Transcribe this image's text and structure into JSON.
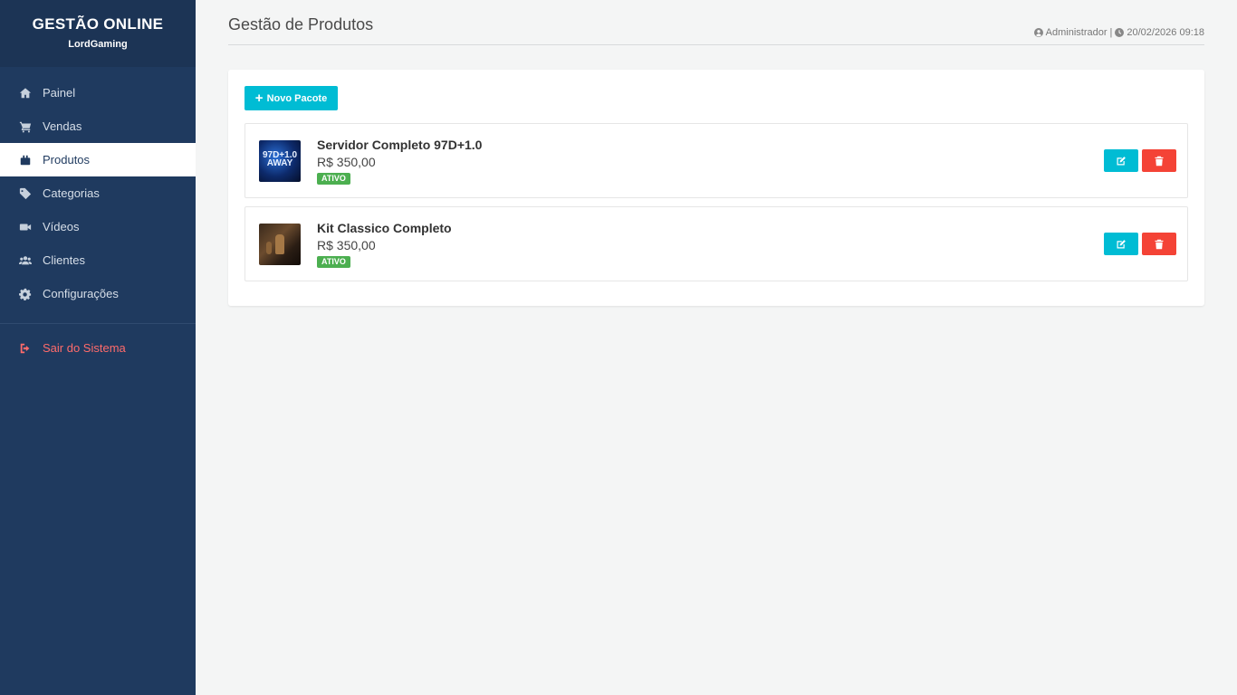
{
  "brand": {
    "title": "GESTÃO ONLINE",
    "subtitle": "LordGaming"
  },
  "sidebar": {
    "items": [
      {
        "label": "Painel",
        "icon": "home-icon"
      },
      {
        "label": "Vendas",
        "icon": "cart-icon"
      },
      {
        "label": "Produtos",
        "icon": "box-icon",
        "active": true
      },
      {
        "label": "Categorias",
        "icon": "tag-icon"
      },
      {
        "label": "Vídeos",
        "icon": "video-icon"
      },
      {
        "label": "Clientes",
        "icon": "users-icon"
      },
      {
        "label": "Configurações",
        "icon": "gear-icon"
      }
    ],
    "logout": {
      "label": "Sair do Sistema",
      "icon": "logout-icon"
    }
  },
  "header": {
    "title": "Gestão de Produtos",
    "user": "Administrador",
    "separator": "|",
    "datetime": "20/02/2026 09:18"
  },
  "toolbar": {
    "new_label": "Novo Pacote"
  },
  "products": [
    {
      "name": "Servidor Completo 97D+1.0",
      "price": "R$ 350,00",
      "status": "ATIVO",
      "thumb_text": "97D+1.0 AWAY"
    },
    {
      "name": "Kit Classico Completo",
      "price": "R$ 350,00",
      "status": "ATIVO"
    }
  ],
  "colors": {
    "sidebar": "#1f3a5f",
    "accent": "#00bcd4",
    "danger": "#f44336",
    "success": "#4caf50",
    "logout": "#ff6b6b"
  }
}
